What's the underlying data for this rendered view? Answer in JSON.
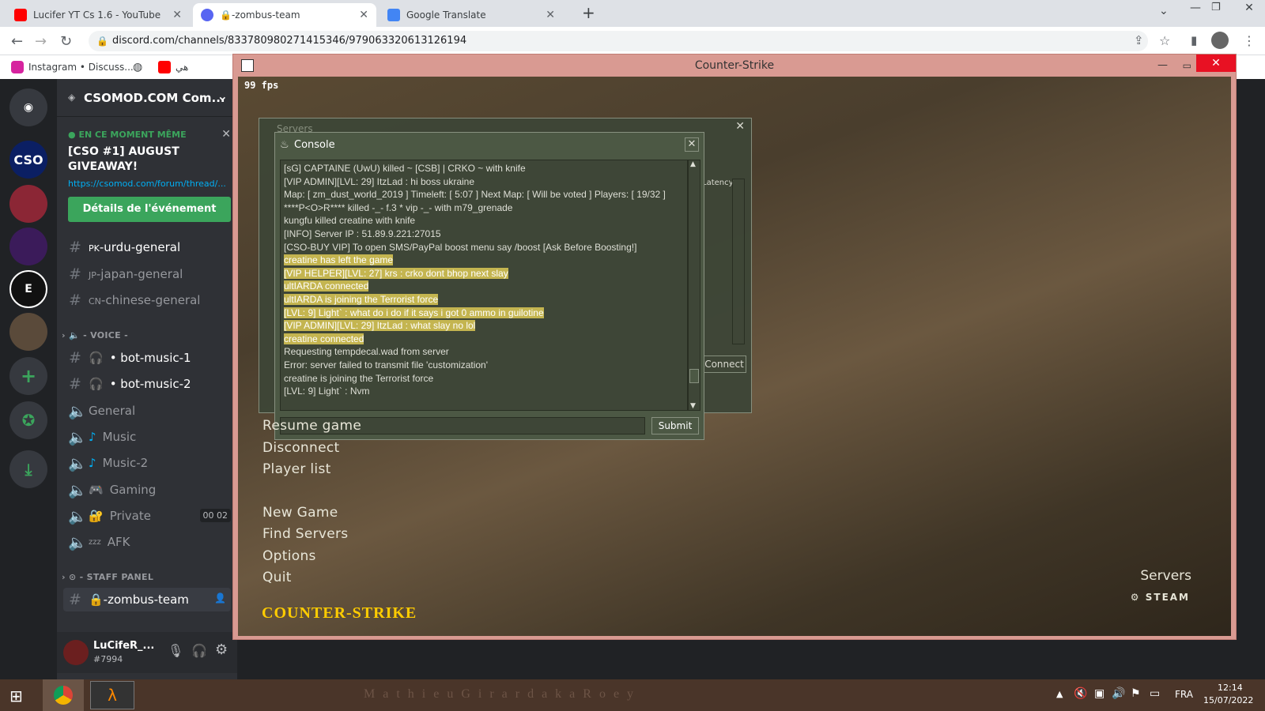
{
  "browser": {
    "tabs": [
      {
        "title": "Lucifer YT Cs 1.6 - YouTube",
        "color": "#ff0000"
      },
      {
        "title": "🔒-zombus-team",
        "color": "#5865f2"
      },
      {
        "title": "Google Translate",
        "color": "#4285f4"
      }
    ],
    "url": "discord.com/channels/833780980271415346/979063320613126194",
    "bookmarks": [
      {
        "label": "Instagram • Discuss..."
      },
      {
        "label": "هي"
      }
    ]
  },
  "discord": {
    "server_name": "CSOMOD.COM Com...",
    "event": {
      "badge": "EN CE MOMENT MÊME",
      "title": "[CSO #1] AUGUST GIVEAWAY!",
      "link": "https://csomod.com/forum/thread/...",
      "button": "Détails de l'événement"
    },
    "channels": [
      {
        "prefix": "PK",
        "name": "-urdu-general",
        "bright": true
      },
      {
        "prefix": "JP",
        "name": "-japan-general",
        "bright": false
      },
      {
        "prefix": "CN",
        "name": "-chinese-general",
        "bright": false
      }
    ],
    "voice_category": "- VOICE -",
    "voice_channels": [
      {
        "name": "• bot-music-1",
        "bright": true
      },
      {
        "name": "• bot-music-2",
        "bright": true
      },
      {
        "name": "General",
        "bright": false
      },
      {
        "name": "Music",
        "bright": false
      },
      {
        "name": "Music-2",
        "bright": false
      },
      {
        "name": "Gaming",
        "bright": false
      },
      {
        "name": "Private",
        "bright": false
      },
      {
        "name": "AFK",
        "bright": false
      }
    ],
    "private_counts": [
      "00",
      "02"
    ],
    "staff_category": "- STAFF PANEL",
    "active_channel": "🔒-zombus-team",
    "user": {
      "name": "LuCifeR_...",
      "tag": "#7994"
    },
    "guild_labels": [
      "CSO"
    ]
  },
  "cs": {
    "window_title": "Counter-Strike",
    "fps": "99 fps",
    "servers_panel_title": "Servers",
    "servers_col": "Latency",
    "connect_label": "Connect",
    "console": {
      "title": "Console",
      "submit": "Submit",
      "lines": [
        {
          "t": "[sG] CAPTAINE (UwU) killed ~ [CSB] | CRKO ~ with knife",
          "hl": false
        },
        {
          "t": "[VIP ADMIN][LVL: 29] ItzLad : hi boss ukraine",
          "hl": false
        },
        {
          "t": "Map: [ zm_dust_world_2019 ] Timeleft: [ 5:07 ] Next Map: [ Will be voted ] Players: [ 19/32 ]",
          "hl": false
        },
        {
          "t": "****P<O>R**** killed -_- f.3 * vip -_- with m79_grenade",
          "hl": false
        },
        {
          "t": "kungfu killed creatine with knife",
          "hl": false
        },
        {
          "t": "[INFO] Server IP : 51.89.9.221:27015",
          "hl": false
        },
        {
          "t": "[CSO-BUY VIP] To open SMS/PayPal boost menu say /boost [Ask Before Boosting!]",
          "hl": false
        },
        {
          "t": "creatine has left the game",
          "hl": true
        },
        {
          "t": "[VIP HELPER][LVL: 27] krs : crko dont bhop next slay",
          "hl": true
        },
        {
          "t": "ultIARDA connected",
          "hl": true
        },
        {
          "t": "ultIARDA is joining the Terrorist force",
          "hl": true
        },
        {
          "t": "[LVL: 9] Light` : what do i do if it says i got 0 ammo in guilotine",
          "hl": true
        },
        {
          "t": "[VIP ADMIN][LVL: 29] ItzLad : what slay no lol",
          "hl": true
        },
        {
          "t": "creatine connected",
          "hl": true
        },
        {
          "t": "Requesting tempdecal.wad from server",
          "hl": false
        },
        {
          "t": "Error: server failed to transmit file 'customization'",
          "hl": false
        },
        {
          "t": "creatine is joining the Terrorist force",
          "hl": false
        },
        {
          "t": "[LVL: 9] Light` : Nvm",
          "hl": false
        }
      ]
    },
    "menu": [
      "Resume game",
      "Disconnect",
      "Player list",
      "New Game",
      "Find Servers",
      "Options",
      "Quit"
    ],
    "logo": "COUNTER-STRIKE",
    "servers_link": "Servers",
    "steam": "STEAM"
  },
  "taskbar": {
    "lang": "FRA",
    "time": "12:14",
    "date": "15/07/2022",
    "wallpaper_text": "M a t h i e u   G i r a r d   a k a   R o e y"
  }
}
